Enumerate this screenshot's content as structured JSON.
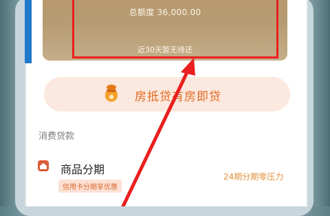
{
  "quota_card": {
    "total_text": "总额度 36,000.00",
    "sub_text": "近30天暂无待还"
  },
  "promo": {
    "label": "房抵贷有房即贷",
    "icon": "money-bag-icon"
  },
  "section": {
    "title": "消费贷款"
  },
  "product": {
    "name": "商品分期",
    "tag": "信用卡分期享优惠",
    "right_note": "24期分期零压力",
    "icon": "home-icon"
  },
  "colors": {
    "highlight_red": "#ea1f1f",
    "card_gold": "#b99a6d",
    "promo_orange": "#e26a22",
    "side_tab_blue": "#1f78c9"
  }
}
